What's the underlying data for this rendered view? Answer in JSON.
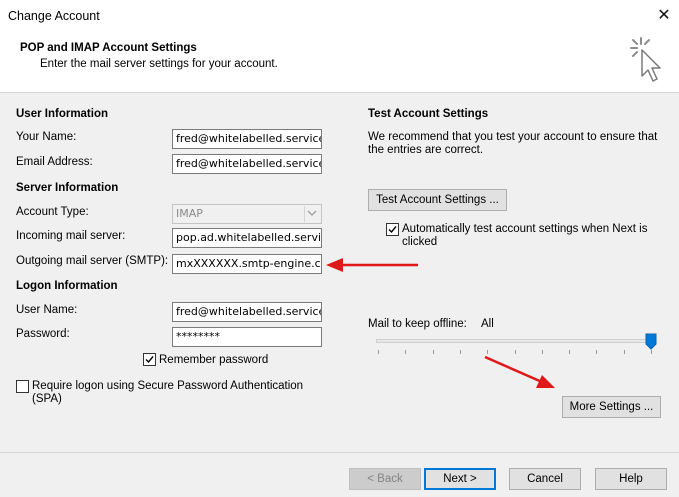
{
  "window": {
    "title": "Change Account",
    "close_icon": "close-icon"
  },
  "header": {
    "title": "POP and IMAP Account Settings",
    "subtitle": "Enter the mail server settings for your account.",
    "icon": "cursor-click-icon"
  },
  "user_information": {
    "heading": "User Information",
    "your_name_label": "Your Name:",
    "your_name_value": "fred@whitelabelled.services",
    "email_label": "Email Address:",
    "email_value": "fred@whitelabelled.services"
  },
  "server_information": {
    "heading": "Server Information",
    "account_type_label": "Account Type:",
    "account_type_value": "IMAP",
    "incoming_label": "Incoming mail server:",
    "incoming_value": "pop.ad.whitelabelled.services",
    "outgoing_label": "Outgoing mail server (SMTP):",
    "outgoing_value": "mxXXXXXX.smtp-engine.com"
  },
  "logon_information": {
    "heading": "Logon Information",
    "user_name_label": "User Name:",
    "user_name_value": "fred@whitelabelled.services",
    "password_label": "Password:",
    "password_value": "********",
    "remember_password_label": "Remember password",
    "remember_password_checked": true,
    "spa_label": "Require logon using Secure Password Authentication (SPA)",
    "spa_checked": false
  },
  "test_account": {
    "heading": "Test Account Settings",
    "description": "We recommend that you test your account to ensure that the entries are correct.",
    "test_button_label": "Test Account Settings ...",
    "auto_test_label": "Automatically test account settings when Next is clicked",
    "auto_test_checked": true
  },
  "offline": {
    "label": "Mail to keep offline:",
    "value": "All",
    "slider_level": 1.0
  },
  "more_settings_label": "More Settings ...",
  "footer": {
    "back_label": "< Back",
    "next_label": "Next >",
    "cancel_label": "Cancel",
    "help_label": "Help"
  },
  "colors": {
    "annotation_arrow": "#e01818",
    "slider_thumb": "#0078d7",
    "focus_border": "#0078d7"
  }
}
